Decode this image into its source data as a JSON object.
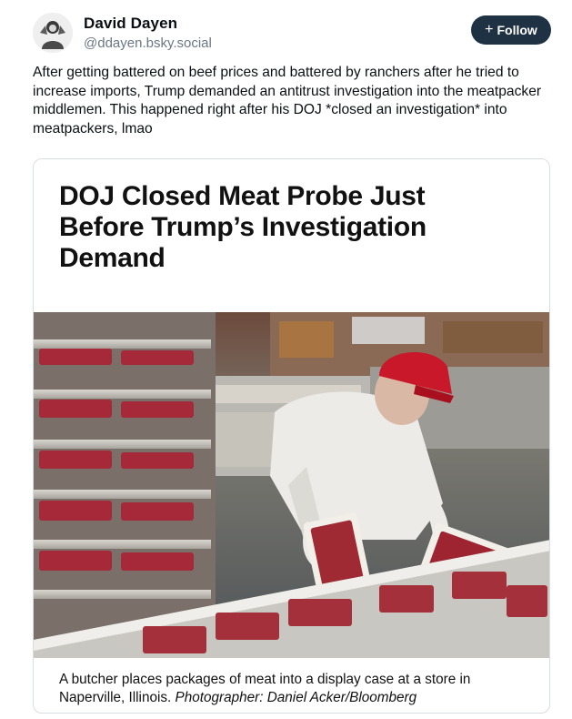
{
  "author": {
    "display_name": "David Dayen",
    "handle": "@ddayen.bsky.social",
    "avatar_icon": "avatar-icon"
  },
  "follow_button": {
    "label": "Follow",
    "plus": "+"
  },
  "post": {
    "text": "After getting battered on beef prices and battered by ranchers after he tried to increase imports, Trump demanded an antitrust investigation into the meatpacker middlemen. This happened right after his DOJ *closed an investigation* into meatpackers, lmao"
  },
  "embed": {
    "headline": "DOJ Closed Meat Probe Just Before Trump’s Investigation Demand",
    "caption": "A butcher places packages of meat into a display case at a store in Naperville, Illinois.",
    "credit": "Photographer: Daniel Acker/Bloomberg"
  },
  "colors": {
    "follow_bg": "#1f3243",
    "handle": "#6a7785",
    "card_border": "#d7dde3",
    "cap_red": "#c8182a"
  }
}
